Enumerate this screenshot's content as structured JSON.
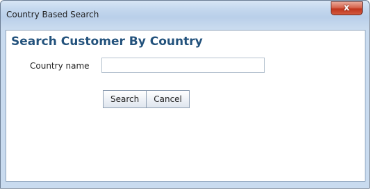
{
  "window": {
    "title": "Country Based Search",
    "close_glyph": "x"
  },
  "form": {
    "heading": "Search Customer By Country",
    "country_label": "Country name",
    "country_value": "",
    "search_label": "Search",
    "cancel_label": "Cancel"
  },
  "colors": {
    "heading": "#23527c",
    "close_button": "#c1361d",
    "frame": "#b9cfe9"
  }
}
